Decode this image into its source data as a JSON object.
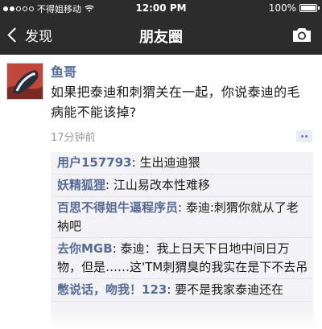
{
  "status_bar": {
    "carrier": "不得姐移动",
    "time": "12:00 PM",
    "battery": "100%"
  },
  "nav": {
    "back_label": "发现",
    "title": "朋友圈",
    "camera_icon": "camera-icon"
  },
  "post": {
    "author": "鱼哥",
    "text": "如果把泰迪和刺猬关在一起，你说泰迪的毛病能不能该掉?",
    "time": "17分钟前"
  },
  "comments": [
    {
      "name": "用户157793",
      "sep": ": ",
      "text": "生出迪迪猥"
    },
    {
      "name": "妖精狐狸",
      "sep": ": ",
      "text": "江山易改本性难移"
    },
    {
      "name": "百思不得姐牛逼程序员",
      "sep": ": ",
      "text": "泰迪:刺猬你就从了老衲吧"
    },
    {
      "name": "去你MGB",
      "sep": ": ",
      "text": "泰迪：我上日天下日地中间日万物，但是……这'TM刺猬臭的我实在是下不去吊"
    },
    {
      "name": "憋说话，吻我！123",
      "sep": ": ",
      "text": "要不是我家泰迪还在"
    }
  ],
  "colors": {
    "bar": "#2c2c2c",
    "name_link": "#576b95",
    "comment_bg": "#f3f3f5"
  }
}
